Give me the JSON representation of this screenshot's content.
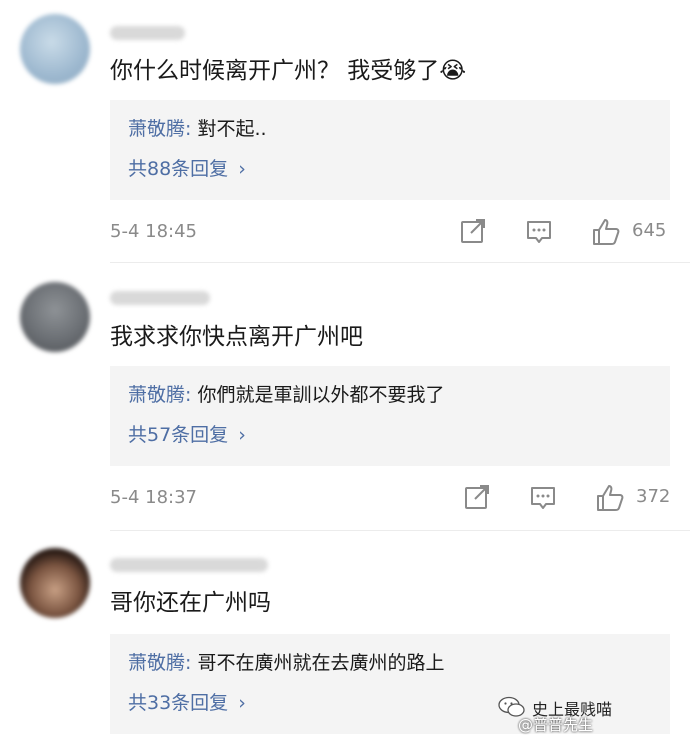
{
  "comments": [
    {
      "text": "你什么时候离开广州？ 我受够了😭",
      "reply_author": "萧敬腾:",
      "reply_text": " 對不起..",
      "more_replies": "共88条回复",
      "timestamp": "5-4 18:45",
      "likes": "645",
      "avatar_color": "#9db8cf"
    },
    {
      "text": "我求求你快点离开广州吧",
      "reply_author": "萧敬腾:",
      "reply_text": " 你們就是軍訓以外都不要我了",
      "more_replies": "共57条回复",
      "timestamp": "5-4 18:37",
      "likes": "372",
      "avatar_color": "#6b6f74"
    },
    {
      "text": "哥你还在广州吗",
      "reply_author": "萧敬腾:",
      "reply_text": " 哥不在廣州就在去廣州的路上",
      "more_replies": "共33条回复",
      "avatar_color": "#3b2a22"
    }
  ],
  "icons": {
    "share": "share-icon",
    "comment": "comment-icon",
    "like": "thumbs-up-icon",
    "chevron": "chevron-right-icon"
  },
  "colors": {
    "accent": "#4e6ea4",
    "reply_bg": "#f4f4f4",
    "meta": "#8a8a8a"
  },
  "watermark": {
    "line1": "史上最贱喵",
    "line2": "@普普先生"
  }
}
